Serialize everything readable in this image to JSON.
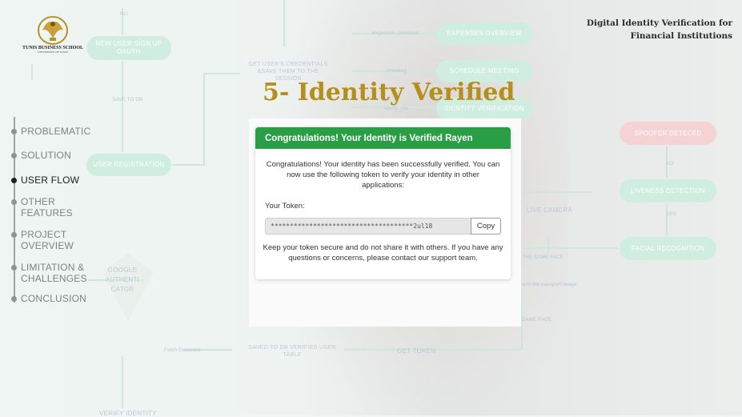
{
  "header": {
    "title_line1": "Digital Identity Verification for",
    "title_line2": "Financial Institutions"
  },
  "logo": {
    "name": "TUNIS BUSINESS SCHOOL",
    "sub": "UNIVERSITY OF TUNIS"
  },
  "nav": {
    "items": [
      {
        "label": "PROBLEMATIC"
      },
      {
        "label": "SOLUTION"
      },
      {
        "label": "USER FLOW",
        "active": true
      },
      {
        "label": "OTHER FEATURES"
      },
      {
        "label": "PROJECT OVERVIEW"
      },
      {
        "label": "LIMITATION & CHALLENGES"
      },
      {
        "label": "CONCLUSION"
      }
    ]
  },
  "section": {
    "heading": "5- Identity Verified"
  },
  "flowchart": {
    "nodes": {
      "new_user": "NEW USER SIGN UP OAUTH",
      "user_registration": "USER REGISTRATION",
      "expenses_overview": "EXPENSES OVERVIEW",
      "schedule_meeting": "SCHEDULE MEETING",
      "identity_verification": "IDENTITY VERIFICATION",
      "spoofer_detected": "SPOOFER DETECED",
      "liveness_detection": "LIVENESS DETECTION",
      "facial_recognition": "FACIAL RECOGNITION",
      "google_authenticator": "GOOGLE AUTHENTI CATOR"
    },
    "labels": {
      "no_top": "NO",
      "save_to_db": "SAVE TO DB",
      "get_credentials": "GET USER'S CREDENTIALS &SAVE THEM TO THE SESSION",
      "expenses_route": "/expenses_overview",
      "meeting_route": "/meeting",
      "verify_route": "/verify_me",
      "no_right": "NO",
      "yes_right": "YES",
      "live_camera": "LIVE CAMERA",
      "same_face": "THE SAME FACE",
      "passport": "with the passport image",
      "same_face_2": "SAME FACE",
      "fetch_db": "Fetch Database",
      "saved_db": "SAVED TO DB VERIFIED USER TABLE",
      "get_token": "GET TOKEN",
      "verify_identity": "VERIFY IDENTITY"
    }
  },
  "card": {
    "header": "Congratulations! Your Identity is Verified Rayen",
    "message": "Congratulations! Your identity has been successfully verified. You can now use the following token to verify your identity in other applications:",
    "token_label": "Your Token:",
    "token_value": "*************************************2ul18",
    "copy_label": "Copy",
    "note": "Keep your token secure and do not share it with others. If you have any questions or concerns, please contact our support team."
  },
  "colors": {
    "success_green": "#2a9e45",
    "heading_gold": "#b58f1c",
    "flow_node_green": "#cfeee0",
    "flow_node_red": "#f6d3d3"
  }
}
